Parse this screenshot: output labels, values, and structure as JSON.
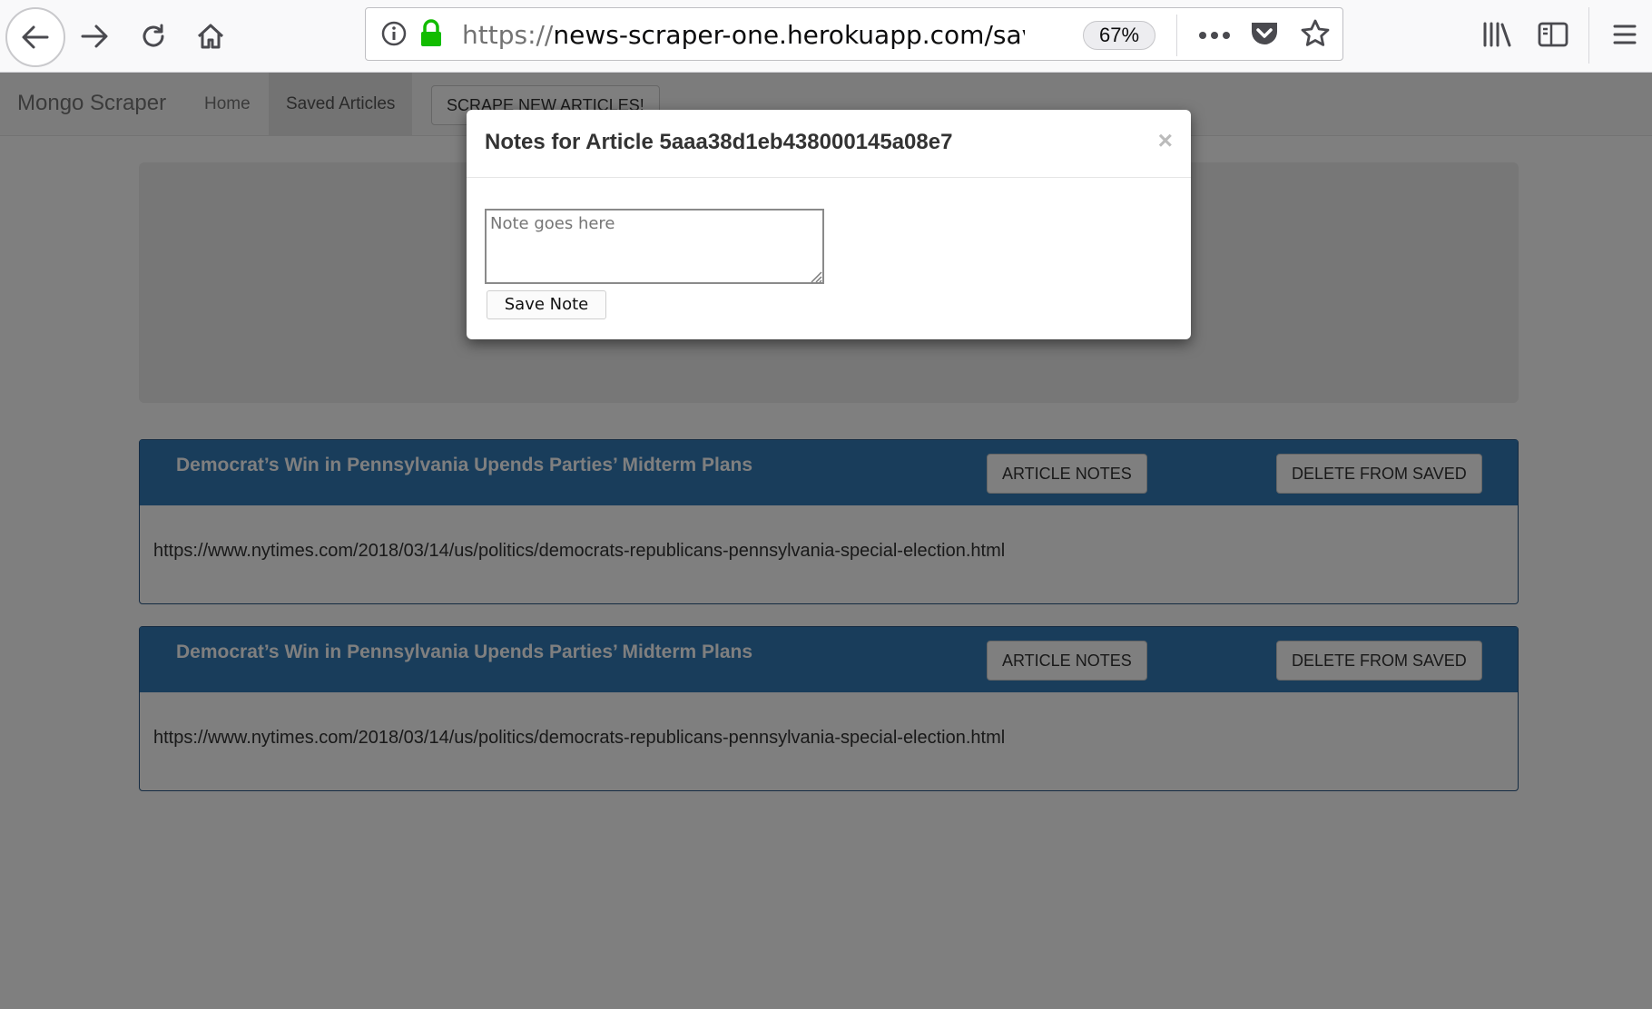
{
  "browser": {
    "url_scheme": "https://",
    "url_rest": "news-scraper-one.herokuapp.com/saved",
    "zoom": "67%",
    "back_icon": "arrow-left-icon",
    "forward_icon": "arrow-right-icon",
    "reload_icon": "reload-icon",
    "home_icon": "home-icon",
    "info_icon": "info-icon",
    "lock_icon": "lock-icon",
    "more_icon": "more-icon",
    "pocket_icon": "pocket-icon",
    "bookmark_icon": "star-icon",
    "library_icon": "library-icon",
    "sidebar_icon": "sidebar-icon",
    "menu_icon": "hamburger-icon",
    "lock_color": "#12bc00"
  },
  "navbar": {
    "brand": "Mongo Scraper",
    "links": [
      "Home",
      "Saved Articles"
    ],
    "scrape_button": "SCRAPE NEW ARTICLES!"
  },
  "articles": [
    {
      "title": "Democrat’s Win in Pennsylvania Upends Parties’ Midterm Plans",
      "notes_button": "ARTICLE NOTES",
      "delete_button": "DELETE FROM SAVED",
      "url": "https://www.nytimes.com/2018/03/14/us/politics/democrats-republicans-pennsylvania-special-election.html"
    },
    {
      "title": "Democrat’s Win in Pennsylvania Upends Parties’ Midterm Plans",
      "notes_button": "ARTICLE NOTES",
      "delete_button": "DELETE FROM SAVED",
      "url": "https://www.nytimes.com/2018/03/14/us/politics/democrats-republicans-pennsylvania-special-election.html"
    }
  ],
  "modal": {
    "title": "Notes for Article 5aaa38d1eb438000145a08e7",
    "close": "×",
    "note_placeholder": "Note goes here",
    "save_button": "Save Note"
  },
  "colors": {
    "card_header": "#337ab7",
    "backdrop": "rgba(0,0,0,0.5)"
  }
}
